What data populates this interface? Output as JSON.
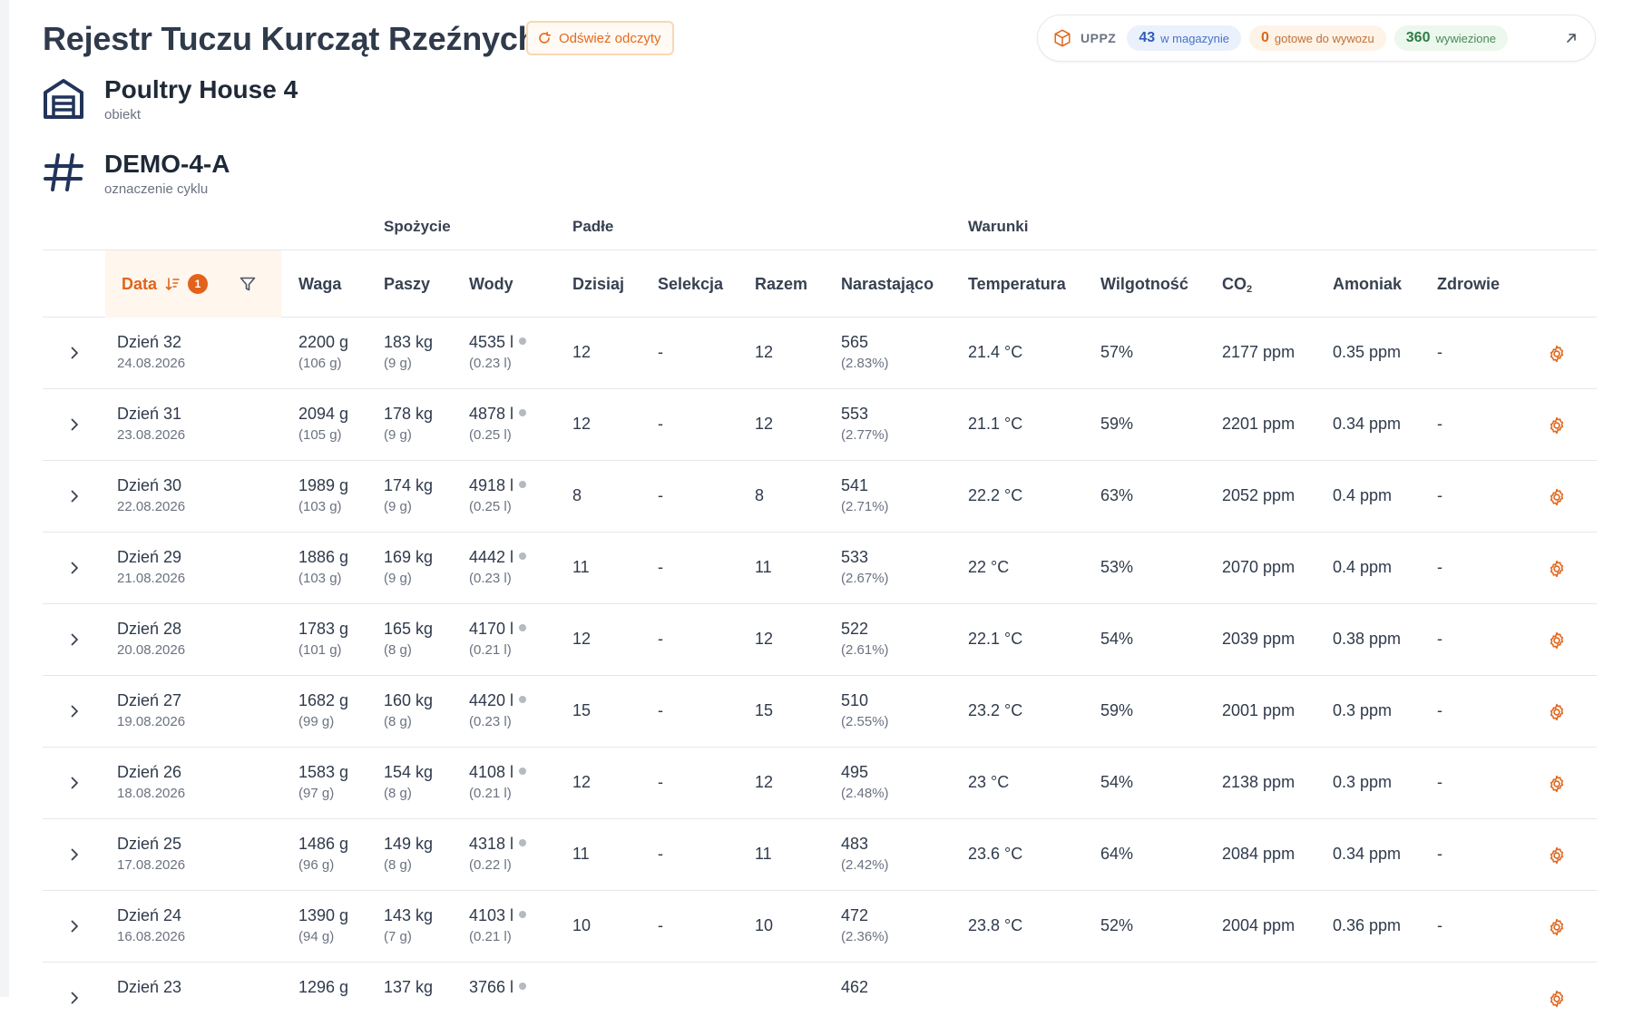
{
  "page": {
    "title": "Rejestr Tuczu Kurcząt Rzeźnych",
    "refresh_label": "Odśwież odczyty"
  },
  "uppz": {
    "label": "UPPZ",
    "stock_count": "43",
    "stock_label": "w magazynie",
    "ready_count": "0",
    "ready_label": "gotowe do wywozu",
    "exported_count": "360",
    "exported_label": "wywiezione"
  },
  "facility": {
    "name": "Poultry House 4",
    "label": "obiekt"
  },
  "cycle": {
    "code": "DEMO-4-A",
    "label": "oznaczenie cyklu"
  },
  "table": {
    "groups": {
      "consumption": "Spożycie",
      "mortality": "Padłe",
      "conditions": "Warunki"
    },
    "headers": {
      "date": "Data",
      "sort_badge": "1",
      "weight": "Waga",
      "feed": "Paszy",
      "water": "Wody",
      "today": "Dzisiaj",
      "selection": "Selekcja",
      "total": "Razem",
      "cumulative": "Narastająco",
      "temperature": "Temperatura",
      "humidity": "Wilgotność",
      "co2_main": "CO",
      "co2_sub": "2",
      "ammonia": "Amoniak",
      "health": "Zdrowie"
    },
    "rows": [
      {
        "day": "Dzień 32",
        "date": "24.08.2026",
        "weight": "2200 g",
        "weight_gain": "(106 g)",
        "feed": "183 kg",
        "feed_per": "(9 g)",
        "water": "4535 l",
        "water_per": "(0.23 l)",
        "today": "12",
        "selection": "-",
        "total": "12",
        "cumulative": "565",
        "cumulative_pct": "(2.83%)",
        "temperature": "21.4 °C",
        "humidity": "57%",
        "co2": "2177 ppm",
        "ammonia": "0.35 ppm",
        "health": "-"
      },
      {
        "day": "Dzień 31",
        "date": "23.08.2026",
        "weight": "2094 g",
        "weight_gain": "(105 g)",
        "feed": "178 kg",
        "feed_per": "(9 g)",
        "water": "4878 l",
        "water_per": "(0.25 l)",
        "today": "12",
        "selection": "-",
        "total": "12",
        "cumulative": "553",
        "cumulative_pct": "(2.77%)",
        "temperature": "21.1 °C",
        "humidity": "59%",
        "co2": "2201 ppm",
        "ammonia": "0.34 ppm",
        "health": "-"
      },
      {
        "day": "Dzień 30",
        "date": "22.08.2026",
        "weight": "1989 g",
        "weight_gain": "(103 g)",
        "feed": "174 kg",
        "feed_per": "(9 g)",
        "water": "4918 l",
        "water_per": "(0.25 l)",
        "today": "8",
        "selection": "-",
        "total": "8",
        "cumulative": "541",
        "cumulative_pct": "(2.71%)",
        "temperature": "22.2 °C",
        "humidity": "63%",
        "co2": "2052 ppm",
        "ammonia": "0.4 ppm",
        "health": "-"
      },
      {
        "day": "Dzień 29",
        "date": "21.08.2026",
        "weight": "1886 g",
        "weight_gain": "(103 g)",
        "feed": "169 kg",
        "feed_per": "(9 g)",
        "water": "4442 l",
        "water_per": "(0.23 l)",
        "today": "11",
        "selection": "-",
        "total": "11",
        "cumulative": "533",
        "cumulative_pct": "(2.67%)",
        "temperature": "22 °C",
        "humidity": "53%",
        "co2": "2070 ppm",
        "ammonia": "0.4 ppm",
        "health": "-"
      },
      {
        "day": "Dzień 28",
        "date": "20.08.2026",
        "weight": "1783 g",
        "weight_gain": "(101 g)",
        "feed": "165 kg",
        "feed_per": "(8 g)",
        "water": "4170 l",
        "water_per": "(0.21 l)",
        "today": "12",
        "selection": "-",
        "total": "12",
        "cumulative": "522",
        "cumulative_pct": "(2.61%)",
        "temperature": "22.1 °C",
        "humidity": "54%",
        "co2": "2039 ppm",
        "ammonia": "0.38 ppm",
        "health": "-"
      },
      {
        "day": "Dzień 27",
        "date": "19.08.2026",
        "weight": "1682 g",
        "weight_gain": "(99 g)",
        "feed": "160 kg",
        "feed_per": "(8 g)",
        "water": "4420 l",
        "water_per": "(0.23 l)",
        "today": "15",
        "selection": "-",
        "total": "15",
        "cumulative": "510",
        "cumulative_pct": "(2.55%)",
        "temperature": "23.2 °C",
        "humidity": "59%",
        "co2": "2001 ppm",
        "ammonia": "0.3 ppm",
        "health": "-"
      },
      {
        "day": "Dzień 26",
        "date": "18.08.2026",
        "weight": "1583 g",
        "weight_gain": "(97 g)",
        "feed": "154 kg",
        "feed_per": "(8 g)",
        "water": "4108 l",
        "water_per": "(0.21 l)",
        "today": "12",
        "selection": "-",
        "total": "12",
        "cumulative": "495",
        "cumulative_pct": "(2.48%)",
        "temperature": "23 °C",
        "humidity": "54%",
        "co2": "2138 ppm",
        "ammonia": "0.3 ppm",
        "health": "-"
      },
      {
        "day": "Dzień 25",
        "date": "17.08.2026",
        "weight": "1486 g",
        "weight_gain": "(96 g)",
        "feed": "149 kg",
        "feed_per": "(8 g)",
        "water": "4318 l",
        "water_per": "(0.22 l)",
        "today": "11",
        "selection": "-",
        "total": "11",
        "cumulative": "483",
        "cumulative_pct": "(2.42%)",
        "temperature": "23.6 °C",
        "humidity": "64%",
        "co2": "2084 ppm",
        "ammonia": "0.34 ppm",
        "health": "-"
      },
      {
        "day": "Dzień 24",
        "date": "16.08.2026",
        "weight": "1390 g",
        "weight_gain": "(94 g)",
        "feed": "143 kg",
        "feed_per": "(7 g)",
        "water": "4103 l",
        "water_per": "(0.21 l)",
        "today": "10",
        "selection": "-",
        "total": "10",
        "cumulative": "472",
        "cumulative_pct": "(2.36%)",
        "temperature": "23.8 °C",
        "humidity": "52%",
        "co2": "2004 ppm",
        "ammonia": "0.36 ppm",
        "health": "-"
      }
    ],
    "partial_row": {
      "day": "Dzień 23",
      "weight": "1296 g",
      "feed": "137 kg",
      "water": "3766 l",
      "cumulative": "462"
    }
  }
}
